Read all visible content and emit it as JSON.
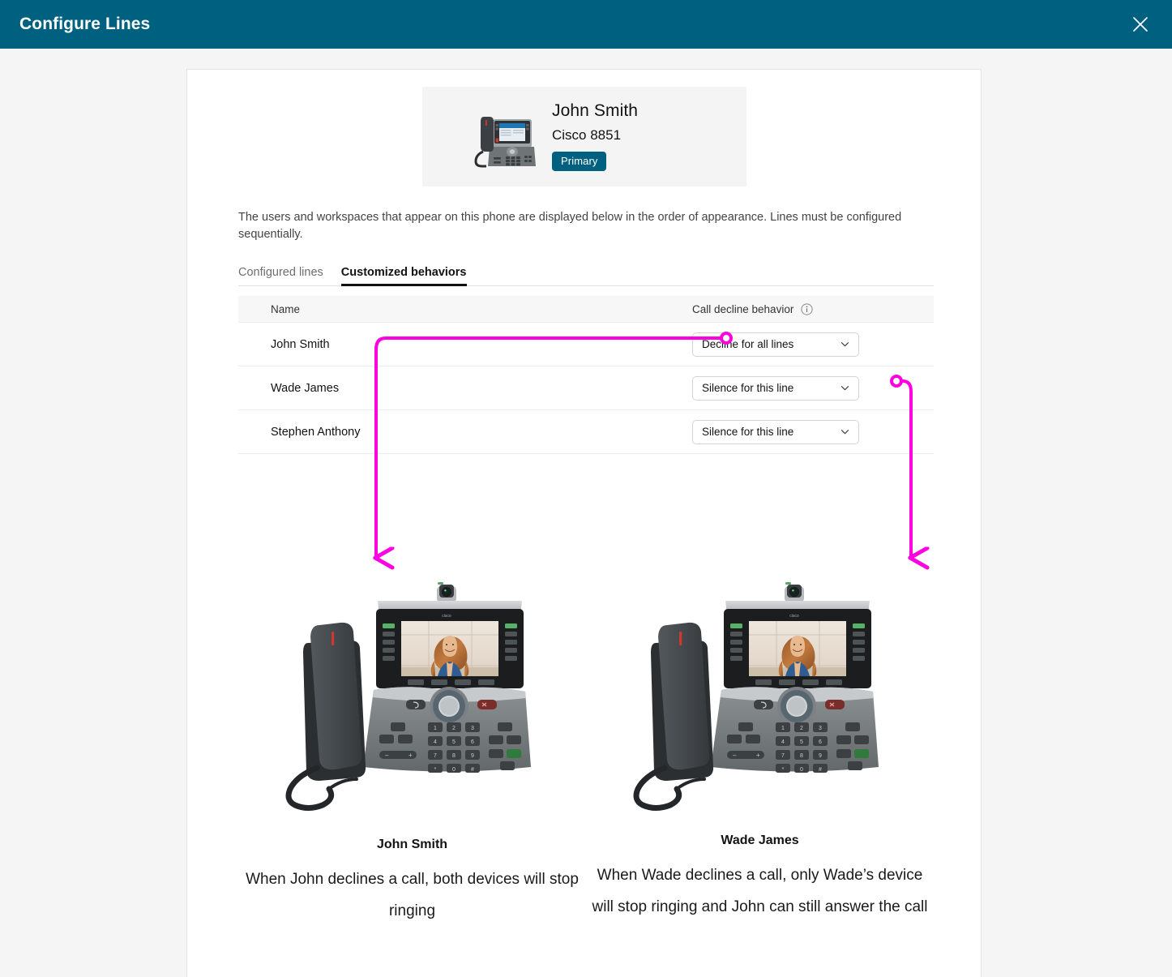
{
  "header": {
    "title": "Configure Lines",
    "close_label": "Close",
    "bar_color": "#00607f"
  },
  "device": {
    "name": "John Smith",
    "model": "Cisco 8851",
    "badge": "Primary",
    "badge_color": "#00607f",
    "thumbnail_icon": "cisco-desk-phone-thumbnail"
  },
  "description": "The users and workspaces that appear on this phone are displayed below in the order of appearance. Lines must be configured sequentially.",
  "tabs": [
    {
      "label": "Configured lines",
      "active": false
    },
    {
      "label": "Customized behaviors",
      "active": true
    }
  ],
  "table": {
    "columns": {
      "name": "Name",
      "behavior": "Call decline behavior",
      "behavior_info_icon": "info-circle-icon"
    },
    "rows": [
      {
        "name": "John Smith",
        "behavior": "Decline for all lines"
      },
      {
        "name": "Wade James",
        "behavior": "Silence for this line"
      },
      {
        "name": "Stephen Anthony",
        "behavior": "Silence for this line"
      }
    ],
    "behavior_options": [
      "Decline for all lines",
      "Silence for this line"
    ]
  },
  "annotations": {
    "color": "#ff00e0",
    "callouts": [
      {
        "source_row": "John Smith",
        "target": "left-phone",
        "marker": "hollow-circle"
      },
      {
        "source_row": "Wade James",
        "target": "right-phone",
        "marker": "hollow-circle"
      }
    ]
  },
  "examples": [
    {
      "owner": "John Smith",
      "caption": "When John declines a call, both devices will stop ringing",
      "device_icon": "cisco-8851-video-phone"
    },
    {
      "owner": "Wade James",
      "caption": "When Wade declines a call, only Wade’s device will stop ringing and John can still answer the call",
      "device_icon": "cisco-8851-video-phone"
    }
  ]
}
